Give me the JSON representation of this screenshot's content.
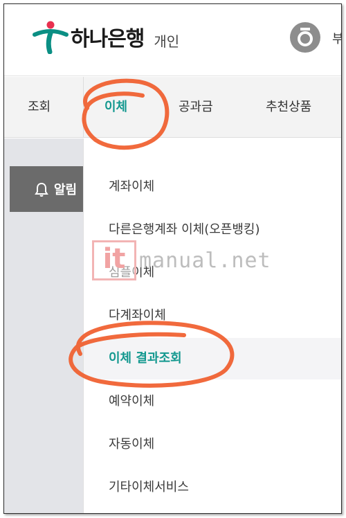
{
  "header": {
    "brand": "하나은행",
    "subtitle": "개인",
    "cut_text": "부"
  },
  "tabs": [
    {
      "label": "조회",
      "active": false
    },
    {
      "label": "이체",
      "active": true
    },
    {
      "label": "공과금",
      "active": false
    },
    {
      "label": "추천상품",
      "active": false
    }
  ],
  "sidebar": {
    "alarm_label": "알림"
  },
  "menu": {
    "items": [
      {
        "label": "계좌이체"
      },
      {
        "label": "다른은행계좌 이체(오픈뱅킹)"
      },
      {
        "label": "심플이체"
      },
      {
        "label": "다계좌이체"
      },
      {
        "label": "이체 결과조회"
      },
      {
        "label": "예약이체"
      },
      {
        "label": "자동이체"
      },
      {
        "label": "기타이체서비스"
      }
    ],
    "highlighted_index": 4
  },
  "watermark": {
    "box_text": "it",
    "text": "manual.net"
  },
  "colors": {
    "accent": "#13988f",
    "annotation": "#f05a28",
    "logo_green": "#0b8f84",
    "logo_red": "#e8304f"
  }
}
